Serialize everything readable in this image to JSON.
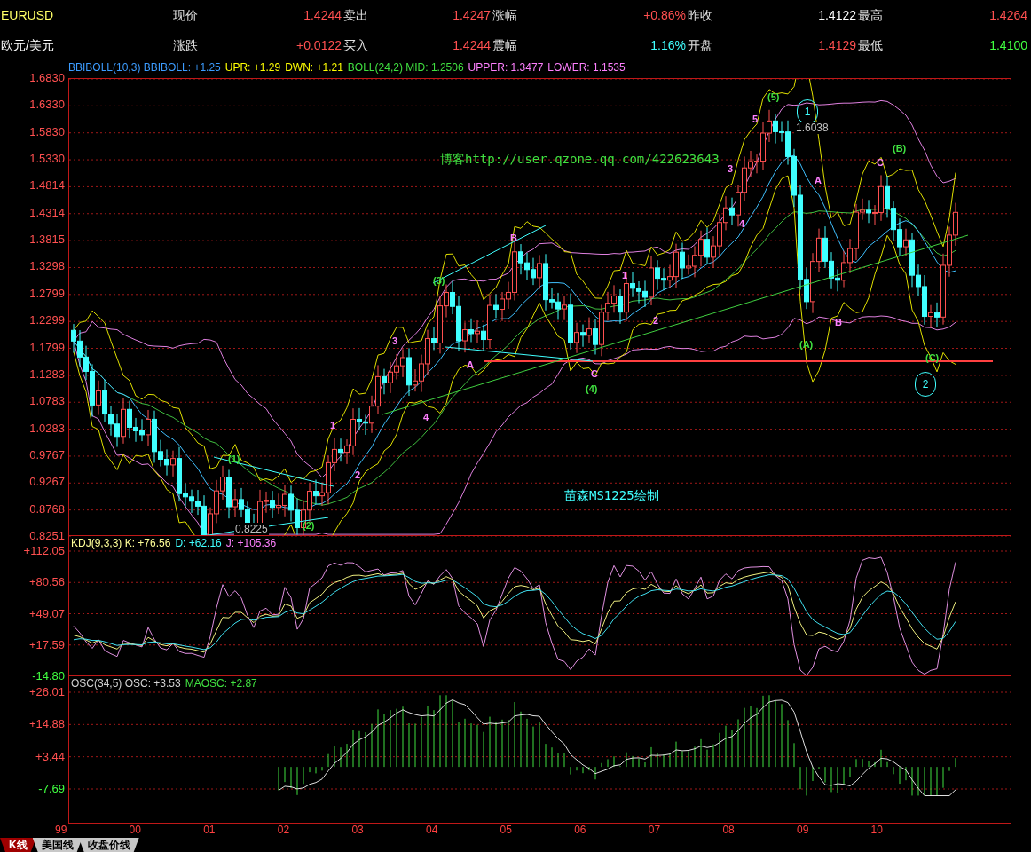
{
  "header": {
    "rows": [
      {
        "symbol": "EURUSD",
        "fields": [
          {
            "label": "现价",
            "value": "1.4244",
            "color": "#ff5050"
          },
          {
            "label": "卖出",
            "value": "1.4247",
            "color": "#ff5050"
          },
          {
            "label": "涨幅",
            "value": "+0.86%",
            "color": "#ff5050"
          },
          {
            "label": "昨收",
            "value": "1.4122",
            "color": "#ffffff"
          },
          {
            "label": "最高",
            "value": "1.4264",
            "color": "#ff5050"
          }
        ]
      },
      {
        "symbol": "欧元/美元",
        "fields": [
          {
            "label": "涨跌",
            "value": "+0.0122",
            "color": "#ff5050"
          },
          {
            "label": "买入",
            "value": "1.4244",
            "color": "#ff5050"
          },
          {
            "label": "震幅",
            "value": "1.16%",
            "color": "#40ffff"
          },
          {
            "label": "开盘",
            "value": "1.4129",
            "color": "#ff5050"
          },
          {
            "label": "最低",
            "value": "1.4100",
            "color": "#40ff40"
          }
        ]
      }
    ]
  },
  "main_panel": {
    "legend": [
      {
        "text": "BBIBOLL(10,3) BBIBOLL: +1.25",
        "color": "#3c9cff"
      },
      {
        "text": "UPR: +1.29",
        "color": "#ffff00"
      },
      {
        "text": "DWN: +1.21",
        "color": "#ffff00"
      },
      {
        "text": "BOLL(24,2) MID: 1.2506",
        "color": "#40e040"
      },
      {
        "text": "UPPER: 1.3477",
        "color": "#ff80ff"
      },
      {
        "text": "LOWER: 1.1535",
        "color": "#ff80ff"
      }
    ],
    "y_labels": [
      "1.6830",
      "1.6330",
      "1.5830",
      "1.5330",
      "1.4814",
      "1.4314",
      "1.3815",
      "1.3298",
      "1.2799",
      "1.2299",
      "1.1799",
      "1.1283",
      "1.0783",
      "1.0283",
      "0.9767",
      "0.9267",
      "0.8768",
      "0.8251"
    ],
    "annotations": [
      {
        "text": "(5)",
        "kind": "wave",
        "color": "#40e040"
      },
      {
        "text": "1",
        "kind": "circled",
        "color": "#40ffff"
      },
      {
        "text": "5",
        "kind": "wave",
        "color": "#ff80ff"
      },
      {
        "text": "1.6038",
        "kind": "price",
        "color": "#c0c0c0"
      },
      {
        "text": "(B)",
        "kind": "wave",
        "color": "#40e040"
      },
      {
        "text": "C",
        "kind": "wave",
        "color": "#ff80ff"
      },
      {
        "text": "3",
        "kind": "wave",
        "color": "#ff80ff"
      },
      {
        "text": "A",
        "kind": "wave",
        "color": "#ff80ff"
      },
      {
        "text": "4",
        "kind": "wave",
        "color": "#ff80ff"
      },
      {
        "text": "B",
        "kind": "wave",
        "color": "#ff80ff"
      },
      {
        "text": "(3)",
        "kind": "wave",
        "color": "#40e040"
      },
      {
        "text": "1",
        "kind": "wave",
        "color": "#ff80ff"
      },
      {
        "text": "2",
        "kind": "wave",
        "color": "#ff80ff"
      },
      {
        "text": "B",
        "kind": "wave",
        "color": "#ff80ff"
      },
      {
        "text": "(A)",
        "kind": "wave",
        "color": "#40e040"
      },
      {
        "text": "3",
        "kind": "wave",
        "color": "#ff80ff"
      },
      {
        "text": "A",
        "kind": "wave",
        "color": "#ff80ff"
      },
      {
        "text": "C",
        "kind": "wave",
        "color": "#ff80ff"
      },
      {
        "text": "(4)",
        "kind": "wave",
        "color": "#40e040"
      },
      {
        "text": "(C)",
        "kind": "wave",
        "color": "#40e040"
      },
      {
        "text": "2",
        "kind": "circled",
        "color": "#40ffff"
      },
      {
        "text": "4",
        "kind": "wave",
        "color": "#ff80ff"
      },
      {
        "text": "1",
        "kind": "wave",
        "color": "#ff80ff"
      },
      {
        "text": "(1)",
        "kind": "wave",
        "color": "#40e040"
      },
      {
        "text": "2",
        "kind": "wave",
        "color": "#ff80ff"
      },
      {
        "text": "(2)",
        "kind": "wave",
        "color": "#40e040"
      },
      {
        "text": "0.8225",
        "kind": "price",
        "color": "#c0c0c0"
      },
      {
        "text": "博客http://user.qzone.qq.com/422623643",
        "kind": "note",
        "color": "#40e040"
      },
      {
        "text": "苗森MS1225绘制",
        "kind": "note",
        "color": "#40ffff"
      }
    ]
  },
  "kdj_panel": {
    "legend": [
      {
        "text": "KDJ(9,3,3) K: +76.56",
        "color": "#ffff99"
      },
      {
        "text": "D: +62.16",
        "color": "#40ffff"
      },
      {
        "text": "J: +105.36",
        "color": "#ff80ff"
      }
    ],
    "y_labels": [
      {
        "text": "+112.05",
        "color": "#ff5050"
      },
      {
        "text": "+80.56",
        "color": "#ff5050"
      },
      {
        "text": "+49.07",
        "color": "#ff5050"
      },
      {
        "text": "+17.59",
        "color": "#ff5050"
      },
      {
        "text": "-14.80",
        "color": "#40ff40"
      }
    ]
  },
  "osc_panel": {
    "legend": [
      {
        "text": "OSC(34,5) OSC: +3.53",
        "color": "#d0d0d0"
      },
      {
        "text": "MAOSC: +2.87",
        "color": "#40e040"
      }
    ],
    "y_labels": [
      {
        "text": "+26.01",
        "color": "#ff5050"
      },
      {
        "text": "+14.88",
        "color": "#ff5050"
      },
      {
        "text": "+3.44",
        "color": "#ff5050"
      },
      {
        "text": "-7.69",
        "color": "#40ff40"
      }
    ]
  },
  "x_labels": [
    "99",
    "00",
    "01",
    "02",
    "03",
    "04",
    "05",
    "06",
    "07",
    "08",
    "09",
    "10"
  ],
  "tabs": [
    {
      "label": "K线",
      "selected": true
    },
    {
      "label": "美国线",
      "selected": false
    },
    {
      "label": "收盘价线",
      "selected": false
    }
  ]
}
